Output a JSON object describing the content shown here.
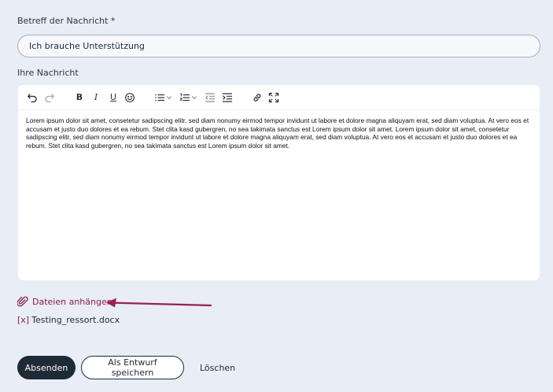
{
  "subject": {
    "label": "Betreff der Nachricht *",
    "value": "Ich brauche Unterstützung"
  },
  "message": {
    "label": "Ihre Nachricht",
    "body": "Lorem ipsum dolor sit amet, consetetur sadipscing elitr, sed diam nonumy eirmod tempor invidunt ut labore et dolore magna aliquyam erat, sed diam voluptua. At vero eos et accusam et justo duo dolores et ea rebum. Stet clita kasd gubergren, no sea takimata sanctus est Lorem ipsum dolor sit amet. Lorem ipsum dolor sit amet, consetetur sadipscing elitr, sed diam nonumy eirmod tempor invidunt ut labore et dolore magna aliquyam erat, sed diam voluptua. At vero eos et accusam et justo duo dolores et ea rebum. Stet clita kasd gubergren, no sea takimata sanctus est Lorem ipsum dolor sit amet."
  },
  "toolbar": {
    "bold": "B",
    "italic": "I",
    "underline": "U",
    "icons": [
      "undo-icon",
      "redo-icon",
      "bold-icon",
      "italic-icon",
      "underline-icon",
      "emoji-icon",
      "bullet-list-icon",
      "numbered-list-icon",
      "outdent-icon",
      "indent-icon",
      "link-icon",
      "fullscreen-icon"
    ]
  },
  "attachments": {
    "link_label": "Dateien anhängen",
    "remove_label": "[x]",
    "files": [
      "Testing_ressort.docx"
    ]
  },
  "actions": {
    "submit": "Absenden",
    "draft": "Als Entwurf speichern",
    "delete": "Löschen"
  },
  "colors": {
    "page_background": "#e9edf5",
    "primary_button": "#1f2a37",
    "accent": "#8b1f4d",
    "annotation_arrow": "#9b1f55"
  }
}
